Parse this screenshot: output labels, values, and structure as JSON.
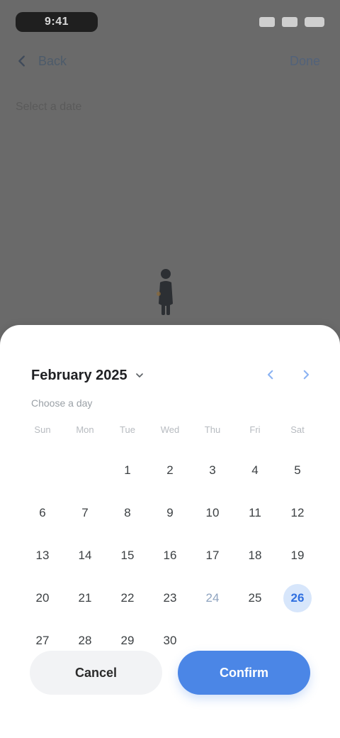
{
  "status": {
    "time": "9:41"
  },
  "header": {
    "back_label": "Back",
    "action_label": "Done"
  },
  "page": {
    "subheading": "Select a date"
  },
  "calendar": {
    "month_label": "February 2025",
    "subtitle": "Choose a day",
    "weekdays": [
      "Sun",
      "Mon",
      "Tue",
      "Wed",
      "Thu",
      "Fri",
      "Sat"
    ],
    "days": [
      {
        "label": "",
        "state": "empty"
      },
      {
        "label": "",
        "state": "empty"
      },
      {
        "label": "1",
        "state": "normal"
      },
      {
        "label": "2",
        "state": "normal"
      },
      {
        "label": "3",
        "state": "normal"
      },
      {
        "label": "4",
        "state": "normal"
      },
      {
        "label": "5",
        "state": "normal"
      },
      {
        "label": "6",
        "state": "normal"
      },
      {
        "label": "7",
        "state": "normal"
      },
      {
        "label": "8",
        "state": "normal"
      },
      {
        "label": "9",
        "state": "normal"
      },
      {
        "label": "10",
        "state": "normal"
      },
      {
        "label": "11",
        "state": "normal"
      },
      {
        "label": "12",
        "state": "normal"
      },
      {
        "label": "13",
        "state": "normal"
      },
      {
        "label": "14",
        "state": "normal"
      },
      {
        "label": "15",
        "state": "normal"
      },
      {
        "label": "16",
        "state": "normal"
      },
      {
        "label": "17",
        "state": "normal"
      },
      {
        "label": "18",
        "state": "normal"
      },
      {
        "label": "19",
        "state": "normal"
      },
      {
        "label": "20",
        "state": "normal"
      },
      {
        "label": "21",
        "state": "normal"
      },
      {
        "label": "22",
        "state": "normal"
      },
      {
        "label": "23",
        "state": "normal"
      },
      {
        "label": "24",
        "state": "muted"
      },
      {
        "label": "25",
        "state": "normal"
      },
      {
        "label": "26",
        "state": "selected"
      },
      {
        "label": "27",
        "state": "normal"
      },
      {
        "label": "28",
        "state": "normal"
      },
      {
        "label": "29",
        "state": "normal"
      },
      {
        "label": "30",
        "state": "normal"
      },
      {
        "label": "",
        "state": "empty"
      },
      {
        "label": "",
        "state": "empty"
      },
      {
        "label": "",
        "state": "empty"
      }
    ]
  },
  "actions": {
    "secondary_label": "Cancel",
    "primary_label": "Confirm"
  },
  "icons": {
    "back": "chevron-left-icon",
    "month_caret": "chevron-down-icon",
    "prev": "chevron-left-icon",
    "next": "chevron-right-icon"
  },
  "colors": {
    "accent": "#4b86e6",
    "selected_bg": "#d7e6fb",
    "scrim": "#6a6a6a"
  }
}
